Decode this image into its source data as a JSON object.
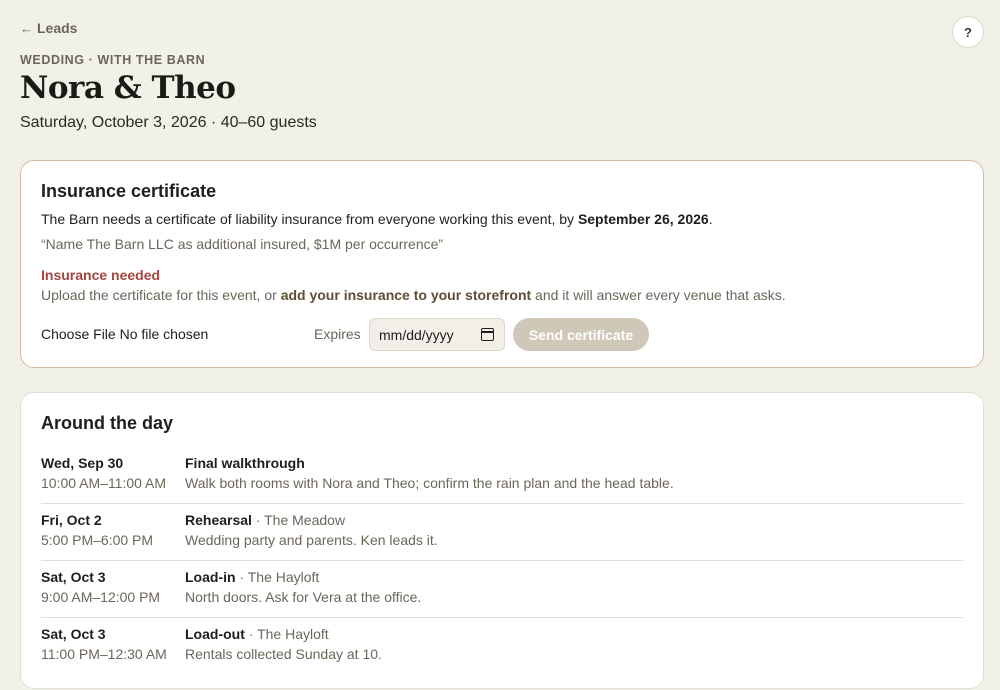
{
  "nav": {
    "back_arrow": "←",
    "back_label": "Leads",
    "help_label": "?"
  },
  "header": {
    "eyebrow": "WEDDING · WITH THE BARN",
    "title": "Nora & Theo",
    "subtitle": "Saturday, October 3, 2026 · 40–60 guests"
  },
  "insurance": {
    "title": "Insurance certificate",
    "request_prefix": "The Barn needs a certificate of liability insurance from everyone working this event, by ",
    "request_deadline": "September 26, 2026",
    "request_suffix": ".",
    "quote": "“Name The Barn LLC as additional insured, $1M per occurrence”",
    "status": "Insurance needed",
    "help_prefix": "Upload the certificate for this event, or ",
    "help_link": "add your insurance to your storefront",
    "help_suffix": " and it will answer every venue that asks.",
    "file_input_text": "Choose File No file chosen",
    "expires_label": "Expires",
    "date_placeholder": "mm/dd/yyyy",
    "send_label": "Send certificate",
    "colors": {
      "status": "#a4453e",
      "button_disabled": "#cfc8b8"
    }
  },
  "around": {
    "title": "Around the day",
    "events": [
      {
        "date": "Wed, Sep 30",
        "time": "10:00 AM–11:00 AM",
        "name": "Final walkthrough",
        "place": "",
        "desc": "Walk both rooms with Nora and Theo; confirm the rain plan and the head table."
      },
      {
        "date": "Fri, Oct 2",
        "time": "5:00 PM–6:00 PM",
        "name": "Rehearsal",
        "place": " · The Meadow",
        "desc": "Wedding party and parents. Ken leads it."
      },
      {
        "date": "Sat, Oct 3",
        "time": "9:00 AM–12:00 PM",
        "name": "Load-in",
        "place": " · The Hayloft",
        "desc": "North doors. Ask for Vera at the office."
      },
      {
        "date": "Sat, Oct 3",
        "time": "11:00 PM–12:30 AM",
        "name": "Load-out",
        "place": " · The Hayloft",
        "desc": "Rentals collected Sunday at 10."
      }
    ]
  }
}
